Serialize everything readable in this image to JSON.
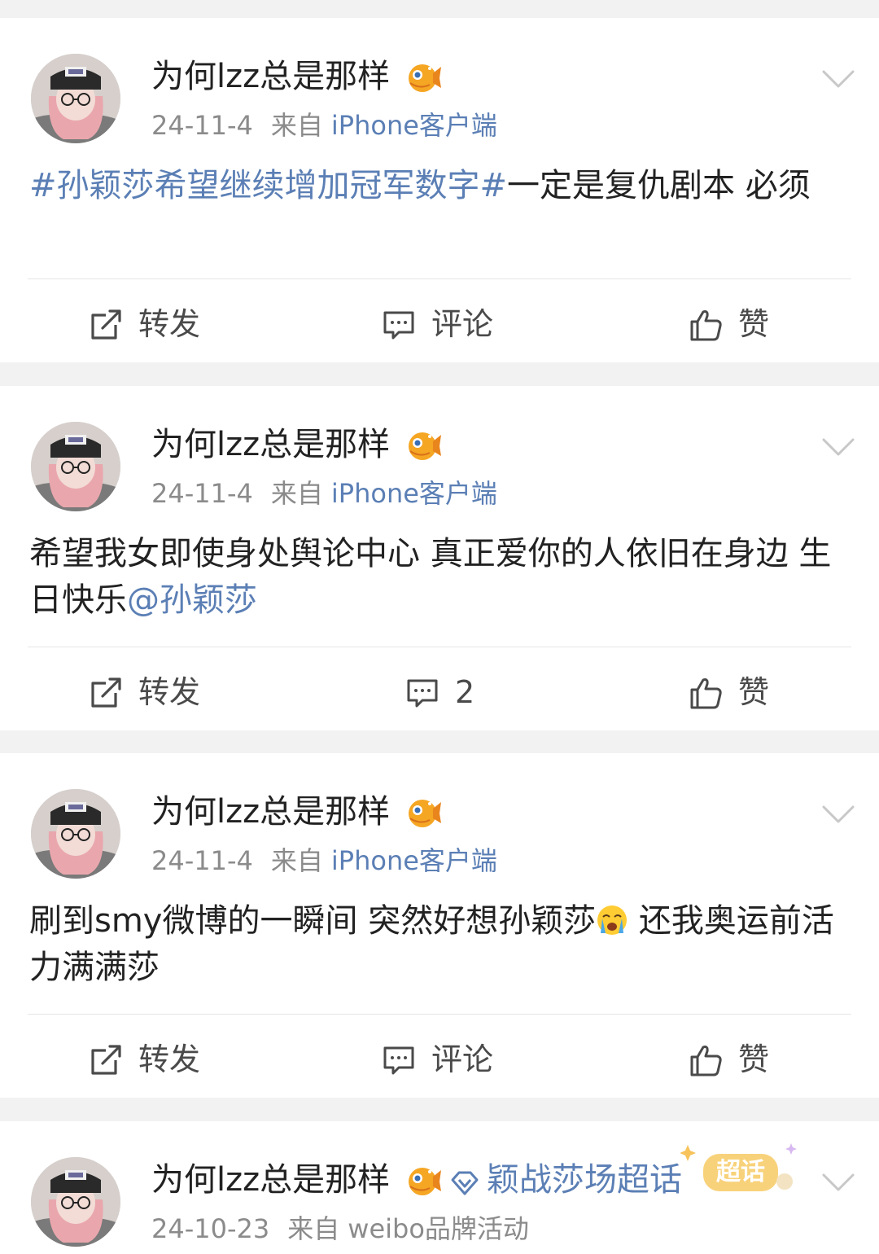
{
  "posts": [
    {
      "user": "为何lzz总是那样",
      "date": "24-11-4",
      "source_prefix": "来自",
      "source": "iPhone客户端",
      "content": {
        "topic": "#孙颖莎希望继续增加冠军数字#",
        "text": "一定是复仇剧本 必须"
      },
      "actions": {
        "repost": "转发",
        "comment": "评论",
        "like": "赞"
      }
    },
    {
      "user": "为何lzz总是那样",
      "date": "24-11-4",
      "source_prefix": "来自",
      "source": "iPhone客户端",
      "content": {
        "text": "希望我女即使身处舆论中心 真正爱你的人依旧在身边 生日快乐",
        "mention": "@孙颖莎"
      },
      "actions": {
        "repost": "转发",
        "comment": "2",
        "like": "赞"
      }
    },
    {
      "user": "为何lzz总是那样",
      "date": "24-11-4",
      "source_prefix": "来自",
      "source": "iPhone客户端",
      "content": {
        "text_before": "刷到smy微博的一瞬间 突然好想孙颖莎",
        "emoji": "crying-face",
        "text_after": " 还我奥运前活力满满莎"
      },
      "actions": {
        "repost": "转发",
        "comment": "评论",
        "like": "赞"
      }
    },
    {
      "user": "为何lzz总是那样",
      "date": "24-10-23",
      "source_prefix": "来自",
      "source": "weibo品牌活动",
      "topic_name": "颖战莎场超话",
      "topic_badge": "超话"
    }
  ],
  "icons": {
    "member_badge": "pufferfish-icon",
    "menu": "chevron-down-icon",
    "repost": "repost-icon",
    "comment": "comment-icon",
    "like": "thumbs-up-icon",
    "topic": "diamond-icon"
  },
  "colors": {
    "link": "#5b7fb5",
    "meta": "#8b8b8b",
    "background": "#f2f2f2",
    "card": "#ffffff"
  }
}
